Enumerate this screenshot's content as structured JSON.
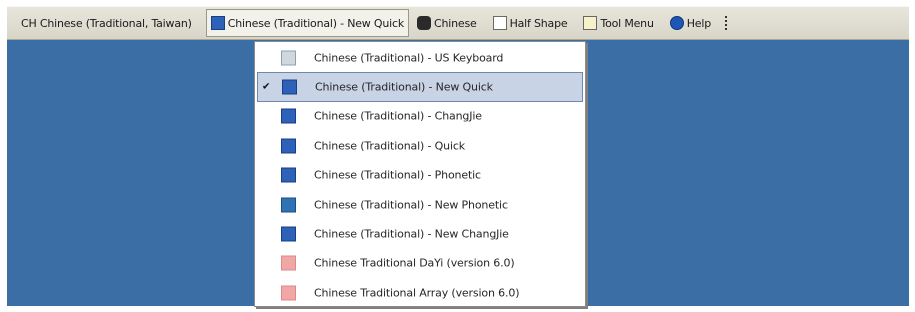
{
  "language_bar": {
    "language": "CH Chinese (Traditional, Taiwan)",
    "current_ime": "Chinese (Traditional) - New Quick",
    "input_mode": "Chinese",
    "shape": "Half Shape",
    "tool_menu": "Tool Menu",
    "help": "Help"
  },
  "menu": {
    "items": [
      {
        "label": "Chinese (Traditional) - US Keyboard",
        "icon": "keyboard-icon",
        "checked": false,
        "icon_color": "#cfd7df"
      },
      {
        "label": "Chinese (Traditional) - New Quick",
        "icon": "new-quick-icon",
        "checked": true,
        "check_mark": "✔",
        "icon_color": "#2d62b8"
      },
      {
        "label": "Chinese (Traditional) - ChangJie",
        "icon": "changjie-icon",
        "checked": false,
        "icon_color": "#2d62b8"
      },
      {
        "label": "Chinese (Traditional) - Quick",
        "icon": "quick-icon",
        "checked": false,
        "icon_color": "#2d62b8"
      },
      {
        "label": "Chinese (Traditional) - Phonetic",
        "icon": "phonetic-icon",
        "checked": false,
        "icon_color": "#2d62b8"
      },
      {
        "label": "Chinese (Traditional) - New Phonetic",
        "icon": "new-phonetic-icon",
        "checked": false,
        "icon_color": "#2f73b4"
      },
      {
        "label": "Chinese (Traditional) - New ChangJie",
        "icon": "new-changjie-icon",
        "checked": false,
        "icon_color": "#2d62b8"
      },
      {
        "label": "Chinese Traditional DaYi (version 6.0)",
        "icon": "dayi-icon",
        "checked": false,
        "icon_color": "#f2a7a7"
      },
      {
        "label": "Chinese Traditional Array (version 6.0)",
        "icon": "array-icon",
        "checked": false,
        "icon_color": "#f2a7a7"
      }
    ]
  },
  "colors": {
    "desktop": "#3a6ea5",
    "selected_bg": "#c9d3e6"
  }
}
